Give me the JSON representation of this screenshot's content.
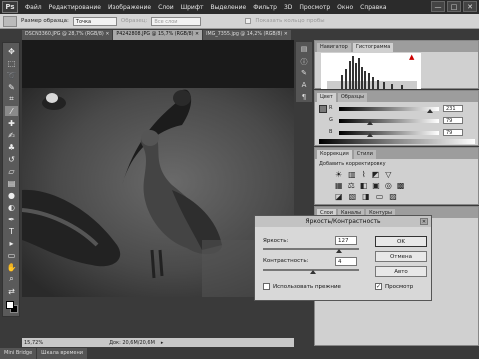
{
  "app": {
    "logo": "Ps",
    "menu": [
      "Файл",
      "Редактирование",
      "Изображение",
      "Слои",
      "Шрифт",
      "Выделение",
      "Фильтр",
      "3D",
      "Просмотр",
      "Окно",
      "Справка"
    ],
    "window_controls": [
      "—",
      "□",
      "✕"
    ]
  },
  "options": {
    "sample_size_label": "Размер образца:",
    "sample_size_value": "Точка",
    "sample_label": "Образец:",
    "sample_value": "Все слои",
    "show_ring_label": "Показать кольцо пробы"
  },
  "tabs": [
    {
      "label": "DSCN3360.JPG @ 28,7% (RGB/8) ✕",
      "active": false
    },
    {
      "label": "P4242808.JPG @ 15,7% (RGB/8) ✕",
      "active": true
    },
    {
      "label": "IMG_7355.jpg @ 14,2% (RGB/8) ✕",
      "active": false
    }
  ],
  "status": {
    "zoom": "15,72%",
    "doc": "Док: 20,6M/20,6M"
  },
  "bottom_tabs": [
    "Mini Bridge",
    "Шкала времени"
  ],
  "panels": {
    "navigator_tabs": [
      "Навигатор",
      "Гистограмма"
    ],
    "color_tabs": [
      "Цвет",
      "Образцы"
    ],
    "color": {
      "channels": [
        {
          "label": "R",
          "value": "231",
          "level": 0.905
        },
        {
          "label": "G",
          "value": "79",
          "level": 0.31
        },
        {
          "label": "B",
          "value": "79",
          "level": 0.31
        }
      ]
    },
    "adjust_tabs": [
      "Коррекция",
      "Стили"
    ],
    "adjust_title": "Добавить корректировку",
    "layers_tabs": [
      "Слои",
      "Каналы",
      "Контуры"
    ]
  },
  "dialog": {
    "title": "Яркость/Контрастность",
    "close": "✕",
    "brightness_label": "Яркость:",
    "brightness_value": "127",
    "brightness_level": 0.79,
    "contrast_label": "Контрастность:",
    "contrast_value": "4",
    "contrast_level": 0.52,
    "legacy_label": "Использовать прежние",
    "legacy_checked": false,
    "ok_label": "OK",
    "cancel_label": "Отмена",
    "auto_label": "Авто",
    "preview_label": "Просмотр",
    "preview_checked": true
  },
  "colors": {
    "foreground": "#ffffff",
    "background": "#000000"
  }
}
